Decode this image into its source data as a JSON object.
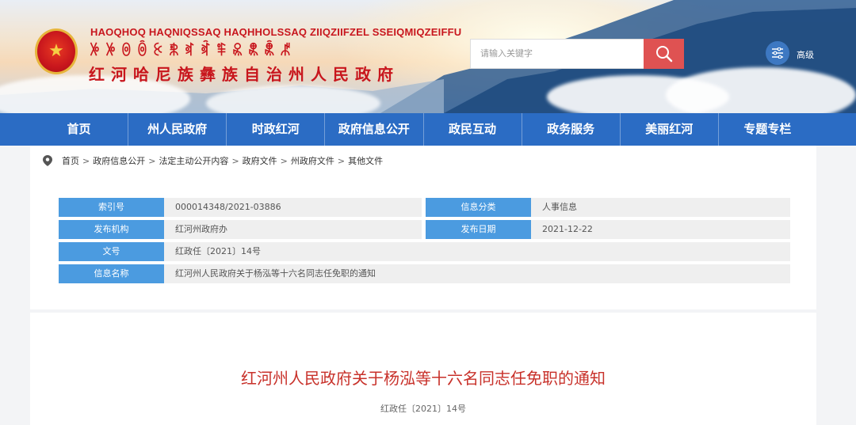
{
  "header": {
    "title_latin": "HAOQHOQ HAQNIQSSAQ HAQHHOLSSAQ ZIIQZIIFZEL SSEIQMIQZEIFFU",
    "title_yi": "ꉼꉼꉻꉺꉹꉸꉷꉶꉵꉴꉳꉲꉱ",
    "title_cn": "红河哈尼族彝族自治州人民政府",
    "emblem_icon": "national-emblem",
    "search_placeholder": "请输入关键字",
    "search_icon": "search-icon",
    "advanced_label": "高级",
    "accent_color": "#c8161d",
    "search_button_color": "#df5252"
  },
  "nav": {
    "items": [
      "首页",
      "州人民政府",
      "时政红河",
      "政府信息公开",
      "政民互动",
      "政务服务",
      "美丽红河",
      "专题专栏"
    ],
    "color": "#2b6cc4"
  },
  "breadcrumb": {
    "items": [
      "首页",
      "政府信息公开",
      "法定主动公开内容",
      "政府文件",
      "州政府文件",
      "其他文件"
    ],
    "separator": ">"
  },
  "meta": {
    "label_color": "#4b9be0",
    "index_label": "索引号",
    "index_value": "000014348/2021-03886",
    "category_label": "信息分类",
    "category_value": "人事信息",
    "publisher_label": "发布机构",
    "publisher_value": "红河州政府办",
    "date_label": "发布日期",
    "date_value": "2021-12-22",
    "docno_label": "文号",
    "docno_value": "红政任〔2021〕14号",
    "name_label": "信息名称",
    "name_value": "红河州人民政府关于杨泓等十六名同志任免职的通知"
  },
  "article": {
    "title": "红河州人民政府关于杨泓等十六名同志任免职的通知",
    "doc_number": "红政任〔2021〕14号",
    "title_color": "#c8312a"
  }
}
